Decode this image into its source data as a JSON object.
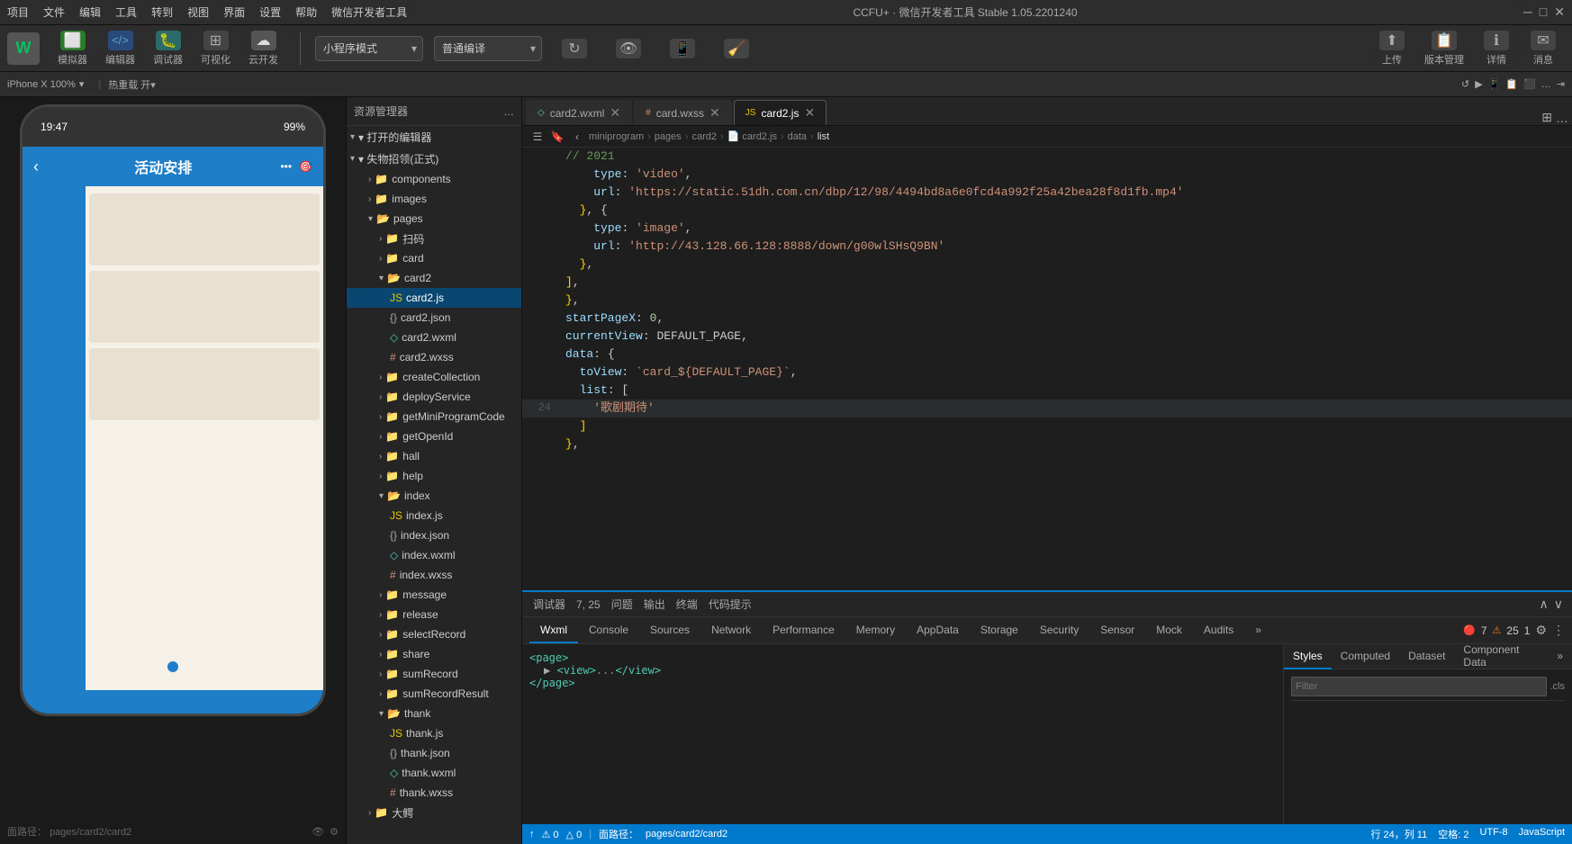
{
  "app": {
    "title": "CCFU+ · 微信开发者工具 Stable 1.05.2201240"
  },
  "menubar": {
    "items": [
      "项目",
      "文件",
      "编辑",
      "工具",
      "转到",
      "视图",
      "界面",
      "设置",
      "帮助",
      "微信开发者工具"
    ]
  },
  "toolbar": {
    "logo_text": "W",
    "buttons": [
      {
        "id": "simulator",
        "label": "模拟器",
        "icon": "⬜"
      },
      {
        "id": "editor",
        "label": "编辑器",
        "icon": "</>"
      },
      {
        "id": "debugger",
        "label": "调试器",
        "icon": "⚙"
      },
      {
        "id": "visible",
        "label": "可视化",
        "icon": "⊞"
      },
      {
        "id": "cloud",
        "label": "云开发",
        "icon": "☁"
      }
    ],
    "mode_dropdown": "小程序模式",
    "compile_dropdown": "普通编译",
    "actions": [
      "↻",
      "👁",
      "📷",
      "⚙",
      "📤",
      "版本管理",
      "详情",
      "消息"
    ],
    "upload_label": "上传",
    "version_label": "版本管理",
    "details_label": "详情",
    "message_label": "消息"
  },
  "toolbar2": {
    "phone_info": "iPhone X  100%",
    "hotreload": "热重载 开▾",
    "icons": [
      "↺",
      "▶",
      "📱",
      "📋",
      "🔲",
      "…",
      "⇥"
    ]
  },
  "phone": {
    "status_time": "19:47",
    "status_battery": "99%",
    "nav_title": "活动安排",
    "nav_back": "‹",
    "nav_icons": [
      "•••",
      "🎯"
    ]
  },
  "filetree": {
    "title": "资源管理器",
    "section_open_editors": "▾ 打开的编辑器",
    "section_lost": "▾ 失物招领(正式)",
    "folders": {
      "components": {
        "name": "components",
        "open": false
      },
      "images": {
        "name": "images",
        "open": false
      },
      "pages": {
        "name": "pages",
        "open": true
      },
      "scan": {
        "name": "扫码",
        "open": false
      },
      "card": {
        "name": "card",
        "open": false
      },
      "card2": {
        "name": "card2",
        "open": true
      },
      "card2_files": [
        {
          "name": "card2.js",
          "type": "js",
          "selected": true
        },
        {
          "name": "card2.json",
          "type": "json"
        },
        {
          "name": "card2.wxml",
          "type": "wxml"
        },
        {
          "name": "card2.wxss",
          "type": "wxss"
        }
      ],
      "createCollection": {
        "name": "createCollection",
        "open": false
      },
      "deployService": {
        "name": "deployService",
        "open": false
      },
      "getMiniProgramCode": {
        "name": "getMiniProgramCode",
        "open": false
      },
      "getOpenId": {
        "name": "getOpenId",
        "open": false
      },
      "hall": {
        "name": "hall",
        "open": false
      },
      "help": {
        "name": "help",
        "open": false
      },
      "index": {
        "name": "index",
        "open": true
      },
      "index_files": [
        {
          "name": "index.js",
          "type": "js"
        },
        {
          "name": "index.json",
          "type": "json"
        },
        {
          "name": "index.wxml",
          "type": "wxml"
        },
        {
          "name": "index.wxss",
          "type": "wxss"
        }
      ],
      "message": {
        "name": "message",
        "open": false
      },
      "release": {
        "name": "release",
        "open": false
      },
      "selectRecord": {
        "name": "selectRecord",
        "open": false
      },
      "share": {
        "name": "share",
        "open": false
      },
      "sumRecord": {
        "name": "sumRecord",
        "open": false
      },
      "sumRecordResult": {
        "name": "sumRecordResult",
        "open": false
      },
      "thank": {
        "name": "thank",
        "open": true
      },
      "thank_files": [
        {
          "name": "thank.js",
          "type": "js"
        },
        {
          "name": "thank.json",
          "type": "json"
        },
        {
          "name": "thank.wxml",
          "type": "wxml"
        },
        {
          "name": "thank.wxss",
          "type": "wxss"
        }
      ],
      "bigArea": {
        "name": "大鳄",
        "open": false
      }
    }
  },
  "editor_tabs": [
    {
      "id": "card2-wxml",
      "label": "card2.wxml",
      "type": "wxml",
      "active": false,
      "closable": true
    },
    {
      "id": "card-wxss",
      "label": "card.wxss",
      "type": "wxss",
      "active": false,
      "closable": true
    },
    {
      "id": "card2-js",
      "label": "card2.js",
      "type": "js",
      "active": true,
      "closable": true
    }
  ],
  "breadcrumb": {
    "items": [
      "miniprogram",
      "pages",
      "card2",
      "card2.js",
      "data",
      "list"
    ]
  },
  "code": {
    "lines": [
      {
        "num": "",
        "content": "// 2021"
      },
      {
        "num": "",
        "content": "    type: 'video',"
      },
      {
        "num": "",
        "content": "    url: 'https://static.51dh.com.cn/dbp/12/98/4494bd8a6e0fcd4a992f25a42bea28f8d1fb.mp4'"
      },
      {
        "num": "",
        "content": "  }, {"
      },
      {
        "num": "",
        "content": "    type: 'image',"
      },
      {
        "num": "",
        "content": "    url: 'http://43.128.66.128:8888/down/g00wlSHsQ9BN'"
      },
      {
        "num": "",
        "content": "  },"
      },
      {
        "num": "",
        "content": "],"
      },
      {
        "num": "",
        "content": "},"
      },
      {
        "num": "",
        "content": "startPageX: 0,"
      },
      {
        "num": "",
        "content": "currentView: DEFAULT_PAGE,"
      },
      {
        "num": "",
        "content": "data: {"
      },
      {
        "num": "",
        "content": "  toView: `card_${DEFAULT_PAGE}`,"
      },
      {
        "num": "",
        "content": "  list: ["
      },
      {
        "num": "24",
        "content": "    '歌剧期待'",
        "highlighted": true
      },
      {
        "num": "",
        "content": "  ]"
      },
      {
        "num": "",
        "content": "},"
      }
    ]
  },
  "devtools": {
    "toolbar_label": "调试器",
    "line_col": "7, 25",
    "tabs_top": [
      "问题",
      "输出",
      "终端",
      "代码提示"
    ],
    "tabs_main": [
      "Wxml",
      "Console",
      "Sources",
      "Network",
      "Performance",
      "Memory",
      "AppData",
      "Storage",
      "Security",
      "Sensor",
      "Mock",
      "Audits",
      "»"
    ],
    "active_tab": "Wxml",
    "error_count": "7",
    "warn_count": "25",
    "info_count": "1",
    "html_content": [
      {
        "tag": "<page>"
      },
      {
        "tag": "  ▶ <view>...</view>"
      },
      {
        "tag": "</page>"
      }
    ],
    "right_tabs": [
      "Styles",
      "Computed",
      "Dataset",
      "Component Data",
      "»"
    ],
    "active_right_tab": "Styles",
    "filter_placeholder": "Filter",
    "filter_cls": ".cls"
  },
  "statusbar": {
    "line": "行 24，列 11",
    "spaces": "空格: 2",
    "encoding": "UTF-8",
    "lang": "JavaScript",
    "path": "面路径：",
    "page_path": "pages/card2/card2",
    "icons": [
      "↑",
      "⚠ 0",
      "△ 0"
    ]
  }
}
